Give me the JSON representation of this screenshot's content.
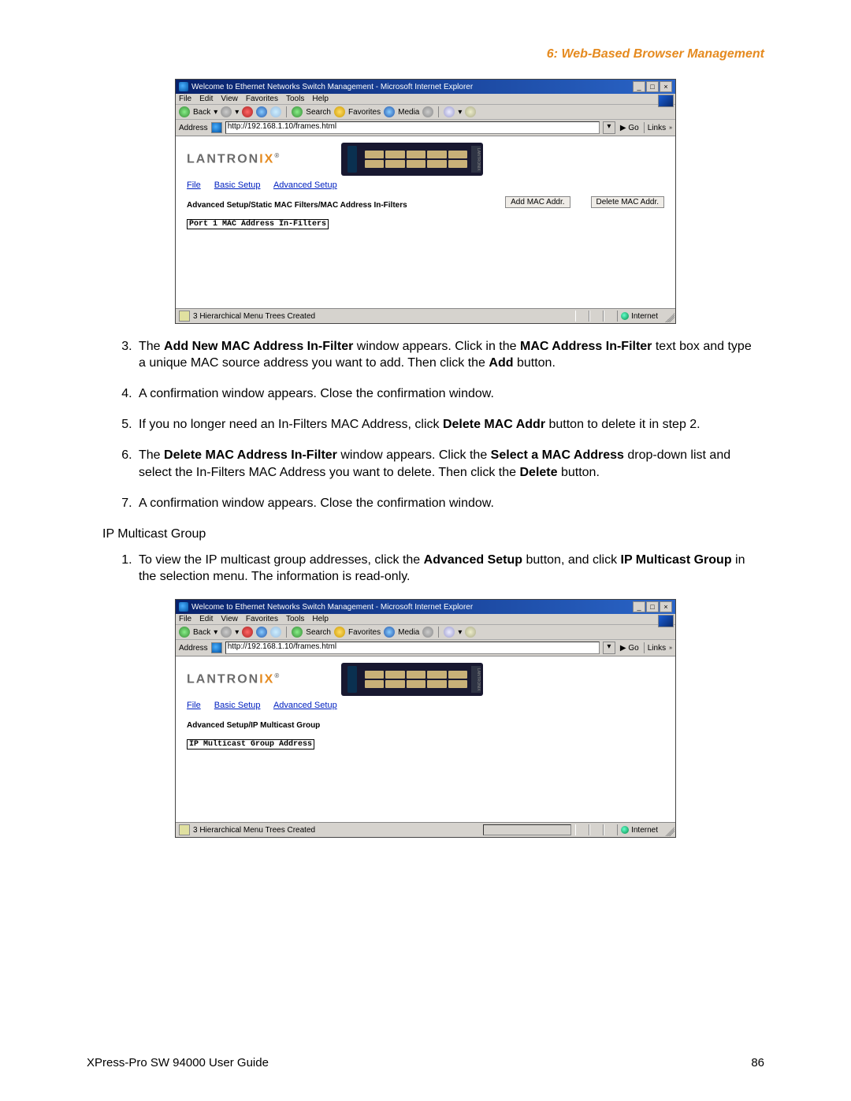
{
  "header": {
    "section_title": "6: Web-Based Browser Management"
  },
  "screenshot1": {
    "title": "Welcome to Ethernet Networks Switch Management - Microsoft Internet Explorer",
    "menu": {
      "file": "File",
      "edit": "Edit",
      "view": "View",
      "favorites": "Favorites",
      "tools": "Tools",
      "help": "Help"
    },
    "toolbar": {
      "back": "Back",
      "search": "Search",
      "favorites": "Favorites",
      "media": "Media"
    },
    "address": {
      "label": "Address",
      "url": "http://192.168.1.10/frames.html",
      "go": "Go",
      "links": "Links"
    },
    "device_side_label": "LANTRONIX",
    "logo_prefix": "LANTRON",
    "logo_suffix": "IX",
    "logo_reg": "®",
    "nav": {
      "file": "File",
      "basic": "Basic Setup",
      "advanced": "Advanced Setup"
    },
    "breadcrumb": "Advanced Setup/Static MAC Filters/MAC Address In-Filters",
    "btn_add": "Add MAC Addr.",
    "btn_delete": "Delete MAC Addr.",
    "box_label": "Port 1 MAC Address In-Filters",
    "status_text": "3 Hierarchical Menu Trees Created",
    "status_zone": "Internet"
  },
  "steps1": {
    "s3": {
      "t1": "The ",
      "b1": "Add New MAC Address In-Filter",
      "t2": " window appears. Click in the ",
      "b2": "MAC Address In-Filter",
      "t3": " text box and type a unique MAC source address you want to add. Then click the ",
      "b3": "Add",
      "t4": " button."
    },
    "s4": "A confirmation window appears. Close the confirmation window.",
    "s5": {
      "t1": "If you no longer need an In-Filters MAC Address, click ",
      "b1": "Delete MAC Addr",
      "t2": " button to delete it in step 2."
    },
    "s6": {
      "t1": "The ",
      "b1": "Delete MAC Address In-Filter",
      "t2": " window appears. Click the ",
      "b2": "Select a MAC Address",
      "t3": " drop-down list and select the In-Filters MAC Address you want to delete. Then click the ",
      "b3": "Delete",
      "t4": " button."
    },
    "s7": "A confirmation window appears. Close the confirmation window."
  },
  "subsection_title": "IP Multicast Group",
  "steps2": {
    "s1": {
      "t1": "To view the IP multicast group addresses, click the ",
      "b1": "Advanced Setup",
      "t2": " button, and click ",
      "b2": "IP Multicast Group",
      "t3": " in the selection menu. The information is read-only."
    }
  },
  "screenshot2": {
    "title": "Welcome to Ethernet Networks Switch Management - Microsoft Internet Explorer",
    "menu": {
      "file": "File",
      "edit": "Edit",
      "view": "View",
      "favorites": "Favorites",
      "tools": "Tools",
      "help": "Help"
    },
    "toolbar": {
      "back": "Back",
      "search": "Search",
      "favorites": "Favorites",
      "media": "Media"
    },
    "address": {
      "label": "Address",
      "url": "http://192.168.1.10/frames.html",
      "go": "Go",
      "links": "Links"
    },
    "device_side_label": "LANTRONIX",
    "logo_prefix": "LANTRON",
    "logo_suffix": "IX",
    "logo_reg": "®",
    "nav": {
      "file": "File",
      "basic": "Basic Setup",
      "advanced": "Advanced Setup"
    },
    "breadcrumb": "Advanced Setup/IP Multicast Group",
    "box_label": "IP Multicast Group Address",
    "status_text": "3 Hierarchical Menu Trees Created",
    "status_zone": "Internet"
  },
  "footer": {
    "guide": "XPress-Pro SW 94000 User Guide",
    "page": "86"
  }
}
